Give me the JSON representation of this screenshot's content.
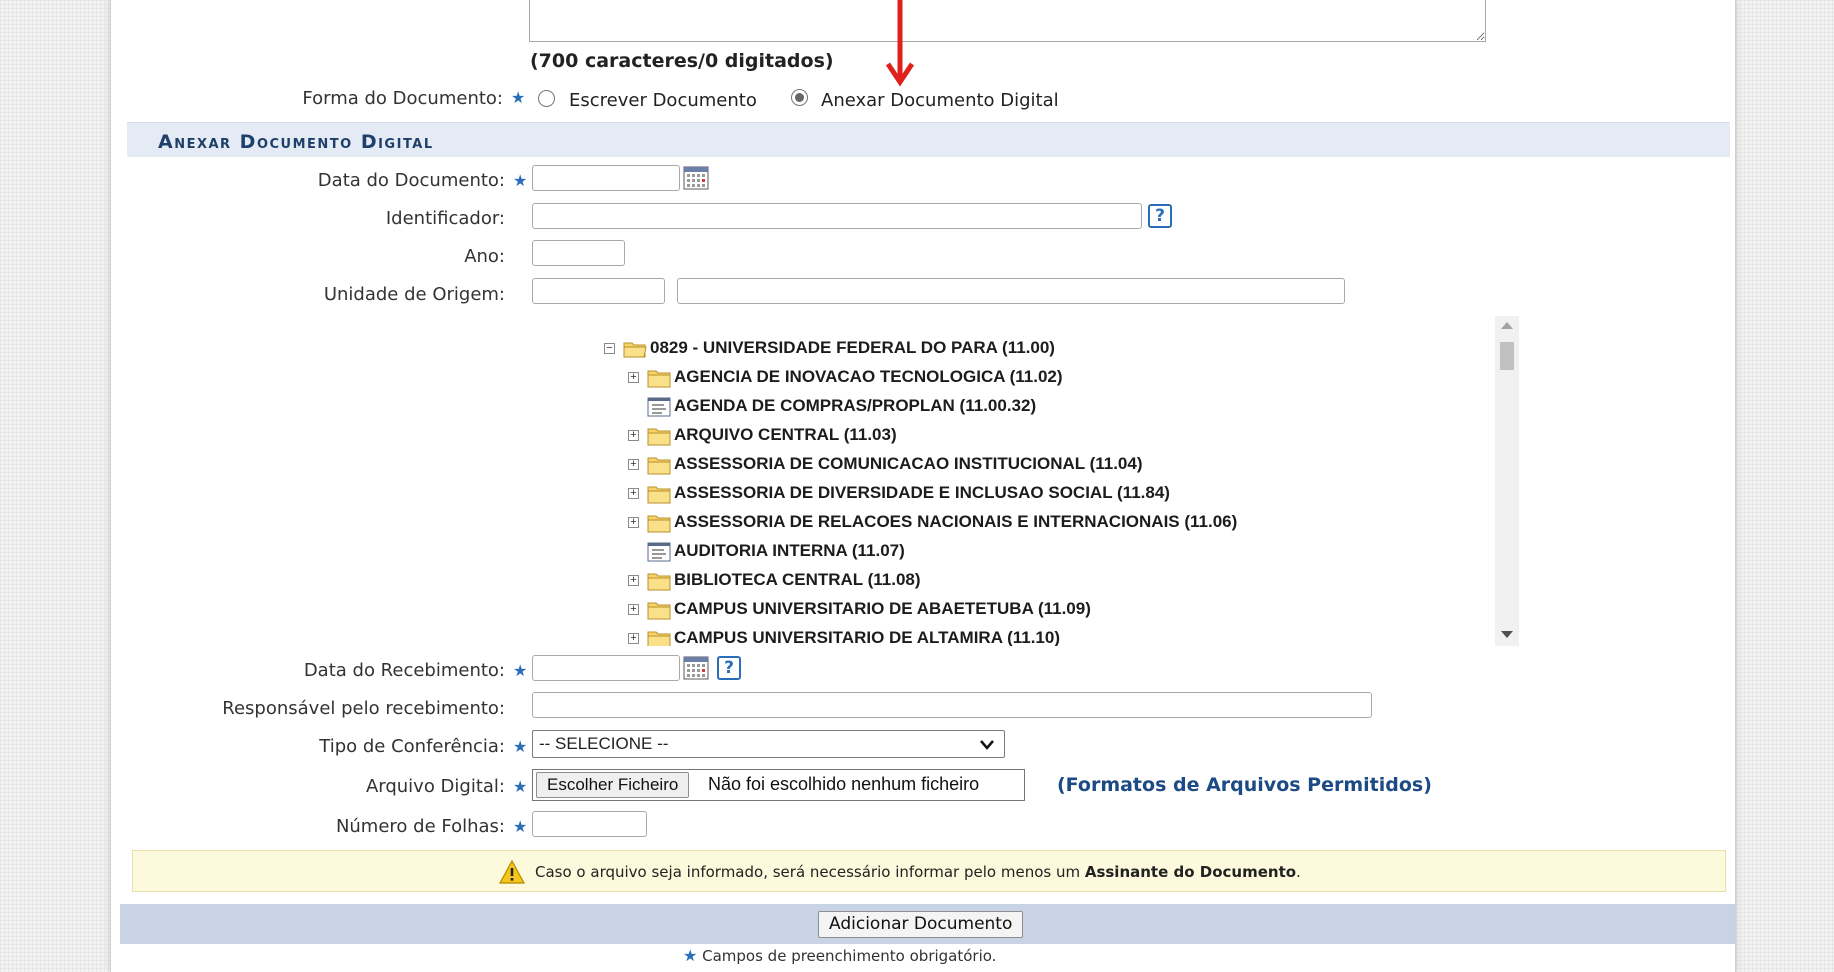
{
  "char_count": "(700 caracteres/0 digitados)",
  "forma": {
    "label": "Forma do Documento:",
    "option_escrever": "Escrever Documento",
    "option_anexar": "Anexar Documento Digital",
    "selected": "Anexar Documento Digital"
  },
  "section_title": "Anexar Documento Digital",
  "fields": {
    "data_documento": "Data do Documento:",
    "identificador": "Identificador:",
    "ano": "Ano:",
    "unidade_origem": "Unidade de Origem:",
    "data_recebimento": "Data do Recebimento:",
    "responsavel": "Responsável pelo recebimento:",
    "tipo_conferencia": "Tipo de Conferência:",
    "arquivo_digital": "Arquivo Digital:",
    "numero_folhas": "Número de Folhas:"
  },
  "tipo_conferencia_selected": "-- SELECIONE --",
  "file": {
    "button": "Escolher Ficheiro",
    "status": "Não foi escolhido nenhum ficheiro"
  },
  "formats_link": "(Formatos de Arquivos Permitidos)",
  "tree": {
    "root": "0829 - UNIVERSIDADE FEDERAL DO PARA (11.00)",
    "items": [
      {
        "label": "AGENCIA DE INOVACAO TECNOLOGICA (11.02)",
        "type": "folder"
      },
      {
        "label": "AGENDA DE COMPRAS/PROPLAN (11.00.32)",
        "type": "leaf"
      },
      {
        "label": "ARQUIVO CENTRAL (11.03)",
        "type": "folder"
      },
      {
        "label": "ASSESSORIA DE COMUNICACAO INSTITUCIONAL (11.04)",
        "type": "folder"
      },
      {
        "label": "ASSESSORIA DE DIVERSIDADE E INCLUSAO SOCIAL (11.84)",
        "type": "folder"
      },
      {
        "label": "ASSESSORIA DE RELACOES NACIONAIS E INTERNACIONAIS (11.06)",
        "type": "folder"
      },
      {
        "label": "AUDITORIA INTERNA (11.07)",
        "type": "leaf"
      },
      {
        "label": "BIBLIOTECA CENTRAL (11.08)",
        "type": "folder"
      },
      {
        "label": "CAMPUS UNIVERSITARIO DE ABAETETUBA (11.09)",
        "type": "folder"
      },
      {
        "label": "CAMPUS UNIVERSITARIO DE ALTAMIRA (11.10)",
        "type": "folder"
      }
    ]
  },
  "warning": {
    "text": "Caso o arquivo seja informado, será necessário informar pelo menos um ",
    "bold": "Assinante do Documento",
    "end": "."
  },
  "submit_button": "Adicionar Documento",
  "required_note": "Campos de preenchimento obrigatório.",
  "colors": {
    "accent": "#2a6db8",
    "section_bg": "#e4ebf4",
    "footer_bg": "#c8d4e6",
    "warning_bg": "#fdf9dc",
    "annotation_arrow": "#e0201b"
  }
}
